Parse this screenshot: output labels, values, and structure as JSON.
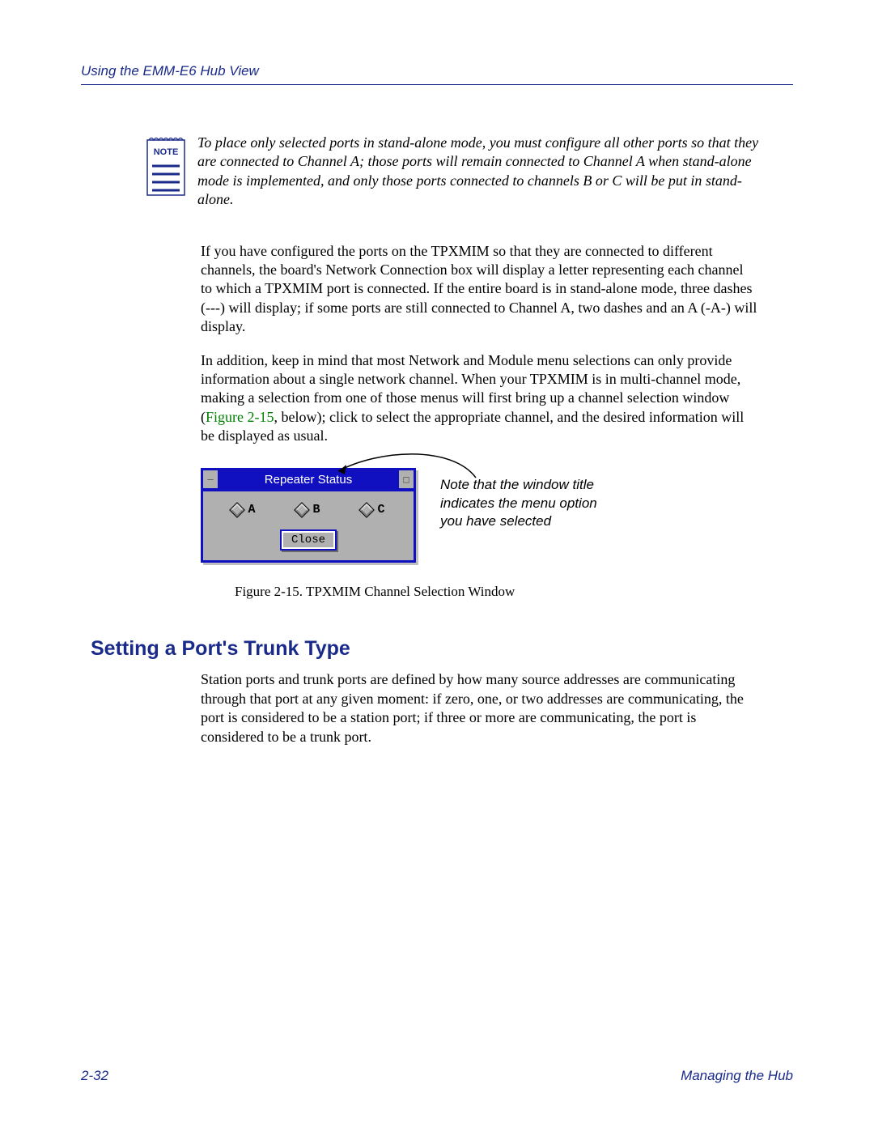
{
  "header": {
    "running_head": "Using the EMM-E6 Hub View"
  },
  "note": {
    "label": "NOTE",
    "text": "To place only selected ports in stand-alone mode, you must configure all other ports so that they are connected to Channel A; those ports will remain connected to Channel A when stand-alone mode is implemented, and only those ports connected to channels B or C will be put in stand-alone."
  },
  "para1": "If you have configured the ports on the TPXMIM so that they are connected to different channels, the board's Network Connection box will display a letter representing each channel to which a TPXMIM port is connected. If the entire board is in stand-alone mode, three dashes (---) will display; if some ports are still connected to Channel A, two dashes and an A (-A-) will display.",
  "para2_pre": "In addition, keep in mind that most Network and Module menu selections can only provide information about a single network channel. When your TPXMIM is in multi-channel mode, making a selection from one of those menus will first bring up a channel selection window (",
  "para2_link": "Figure 2-15",
  "para2_post": ", below); click to select the appropriate channel, and the desired information will be displayed as usual.",
  "figure": {
    "window_title": "Repeater Status",
    "options": [
      "A",
      "B",
      "C"
    ],
    "close_label": "Close",
    "annotation": "Note that the window title indicates the menu option you have selected",
    "caption": "Figure 2-15. TPXMIM Channel Selection Window"
  },
  "section_heading": "Setting a Port's Trunk Type",
  "para3": "Station ports and trunk ports are defined by how many source addresses are communicating through that port at any given moment: if zero, one, or two addresses are communicating, the port is considered to be a station port; if three or more are communicating, the port is considered to be a trunk port.",
  "footer": {
    "page_num": "2-32",
    "chapter": "Managing the Hub"
  }
}
